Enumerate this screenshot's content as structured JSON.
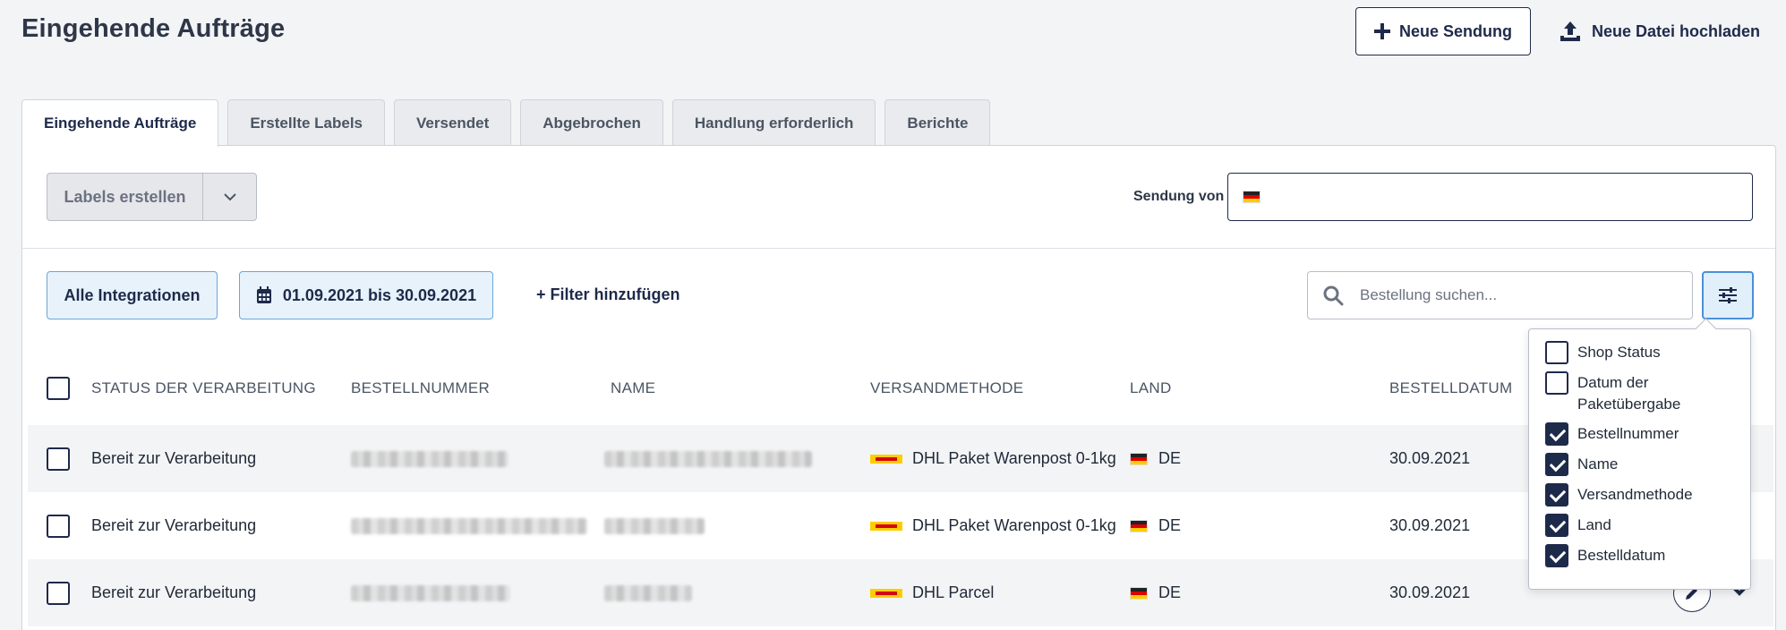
{
  "header": {
    "title": "Eingehende Aufträge",
    "new_shipment": "Neue Sendung",
    "upload_file": "Neue Datei hochladen"
  },
  "tabs": [
    {
      "label": "Eingehende Aufträge",
      "active": true
    },
    {
      "label": "Erstellte Labels"
    },
    {
      "label": "Versendet"
    },
    {
      "label": "Abgebrochen"
    },
    {
      "label": "Handlung erforderlich"
    },
    {
      "label": "Berichte"
    }
  ],
  "toolbar": {
    "create_labels": "Labels erstellen",
    "sender_label": "Sendung von",
    "sender_value": ""
  },
  "filters": {
    "integrations": "Alle Integrationen",
    "date_range": "01.09.2021 bis 30.09.2021",
    "add_filter": "+ Filter hinzufügen",
    "search_placeholder": "Bestellung suchen..."
  },
  "table": {
    "columns": [
      "STATUS DER VERARBEITUNG",
      "BESTELLNUMMER",
      "NAME",
      "VERSANDMETHODE",
      "LAND",
      "BESTELLDATUM"
    ],
    "rows": [
      {
        "status": "Bereit zur Verarbeitung",
        "method": "DHL Paket Warenpost 0-1kg",
        "country": "DE",
        "date": "30.09.2021"
      },
      {
        "status": "Bereit zur Verarbeitung",
        "method": "DHL Paket Warenpost 0-1kg",
        "country": "DE",
        "date": "30.09.2021"
      },
      {
        "status": "Bereit zur Verarbeitung",
        "method": "DHL Parcel",
        "country": "DE",
        "date": "30.09.2021"
      }
    ]
  },
  "column_menu": [
    {
      "label": "Shop Status",
      "checked": false
    },
    {
      "label": "Datum der Paketübergabe",
      "checked": false
    },
    {
      "label": "Bestellnummer",
      "checked": true
    },
    {
      "label": "Name",
      "checked": true
    },
    {
      "label": "Versandmethode",
      "checked": true
    },
    {
      "label": "Land",
      "checked": true
    },
    {
      "label": "Bestelldatum",
      "checked": true
    }
  ],
  "colors": {
    "primary": "#1e2a4a",
    "accent": "#4a90d9",
    "chip_bg": "#e8f2fb"
  },
  "icons": [
    "plus-icon",
    "upload-icon",
    "chevron-down-icon",
    "calendar-icon",
    "search-icon",
    "sliders-icon",
    "dhl-logo-icon",
    "flag-de-icon",
    "pencil-icon"
  ]
}
